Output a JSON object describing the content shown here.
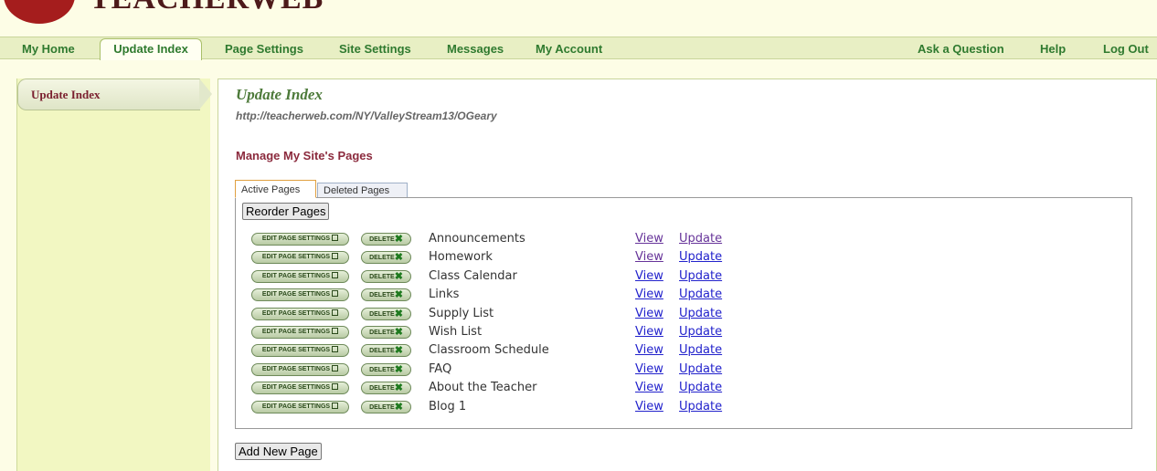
{
  "logo": {
    "text": "TEACHERWEB"
  },
  "nav": {
    "items": [
      {
        "label": "My Home"
      },
      {
        "label": "Update Index"
      },
      {
        "label": "Page Settings"
      },
      {
        "label": "Site Settings"
      },
      {
        "label": "Messages"
      },
      {
        "label": "My Account"
      }
    ],
    "right_items": [
      {
        "label": "Ask a Question"
      },
      {
        "label": "Help"
      },
      {
        "label": "Log Out"
      }
    ]
  },
  "sidebar": {
    "active_label": "Update Index"
  },
  "main": {
    "title": "Update Index",
    "url": "http://teacherweb.com/NY/ValleyStream13/OGeary",
    "section_title": "Manage My Site's Pages",
    "tabs": [
      {
        "label": "Active Pages"
      },
      {
        "label": "Deleted Pages"
      }
    ],
    "reorder_label": "Reorder Pages",
    "edit_label": "EDIT PAGE SETTINGS",
    "delete_label": "DELETE",
    "view_label": "View",
    "update_label": "Update",
    "pages": [
      "Announcements",
      "Homework",
      "Class Calendar",
      "Links",
      "Supply List",
      "Wish List",
      "Classroom Schedule",
      "FAQ",
      "About the Teacher",
      "Blog 1"
    ],
    "add_label": "Add New Page"
  },
  "colors": {
    "nav_text": "#2f7a2f",
    "sidebar_bg": "#f2f7c2",
    "section_title": "#8b2a3d",
    "link": "#2222cc",
    "visited_link": "#663399"
  }
}
